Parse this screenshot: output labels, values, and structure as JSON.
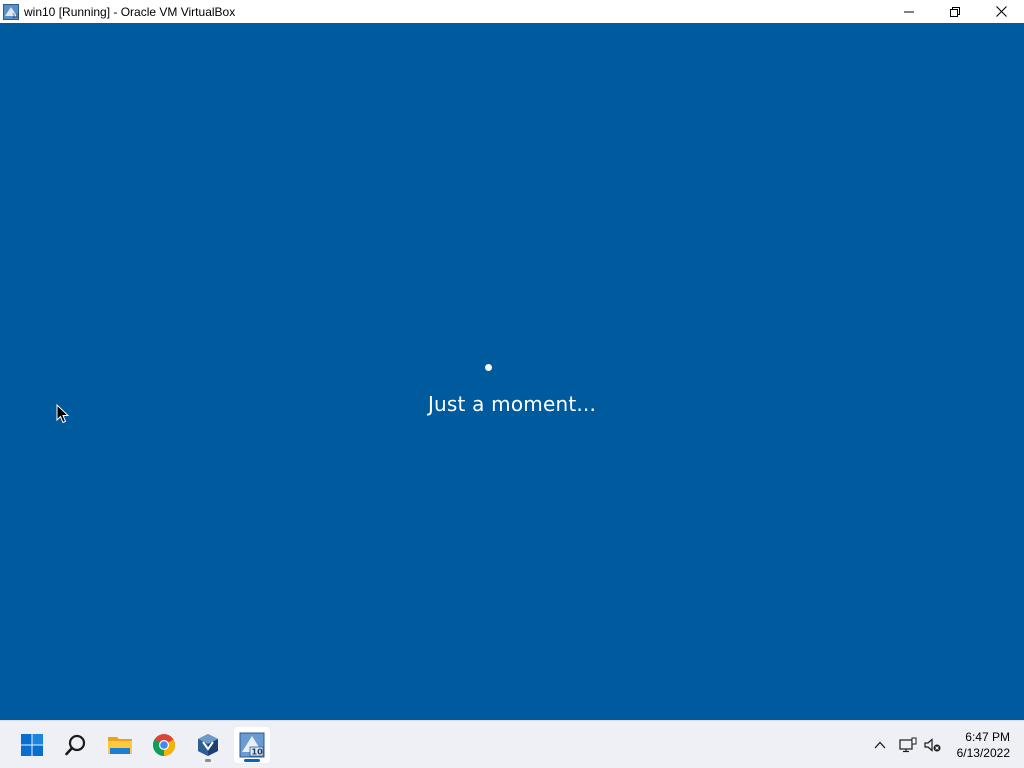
{
  "window": {
    "title": "win10 [Running] - Oracle VM VirtualBox",
    "app_icon": "virtualbox-vm-icon",
    "controls": [
      "minimize-icon",
      "restore-icon",
      "close-icon"
    ]
  },
  "vm_screen": {
    "background_color": "#005a9e",
    "status_text": "Just a moment...",
    "progress_indicator": "spinner-dot-icon"
  },
  "taskbar": {
    "apps": [
      {
        "name": "start",
        "icon": "windows-start-icon"
      },
      {
        "name": "search",
        "icon": "search-icon"
      },
      {
        "name": "file-explorer",
        "icon": "folder-icon"
      },
      {
        "name": "chrome",
        "icon": "chrome-icon"
      },
      {
        "name": "virtualbox",
        "icon": "virtualbox-icon",
        "running": true
      },
      {
        "name": "win10-vm",
        "icon": "vm-win10-icon",
        "active": true
      }
    ],
    "tray": {
      "icons": [
        "chevron-up-icon",
        "network-icon",
        "volume-muted-icon"
      ],
      "time": "6:47 PM",
      "date": "6/13/2022"
    }
  }
}
